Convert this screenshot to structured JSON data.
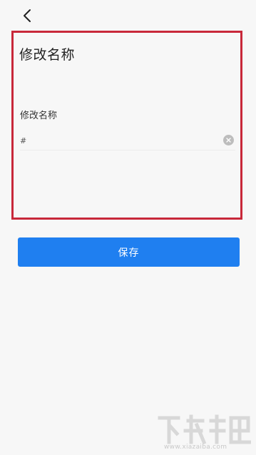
{
  "header": {
    "back_icon": "chevron-left-icon"
  },
  "form": {
    "title": "修改名称",
    "field_label": "修改名称",
    "name_value": "#",
    "clear_icon": "clear-circle-icon"
  },
  "actions": {
    "save_label": "保存"
  },
  "colors": {
    "background": "#f7f7f7",
    "primary_button": "#1f7ff0",
    "highlight_border": "#c8283a"
  },
  "watermark": {
    "site": "www.xiazaiba.com"
  }
}
